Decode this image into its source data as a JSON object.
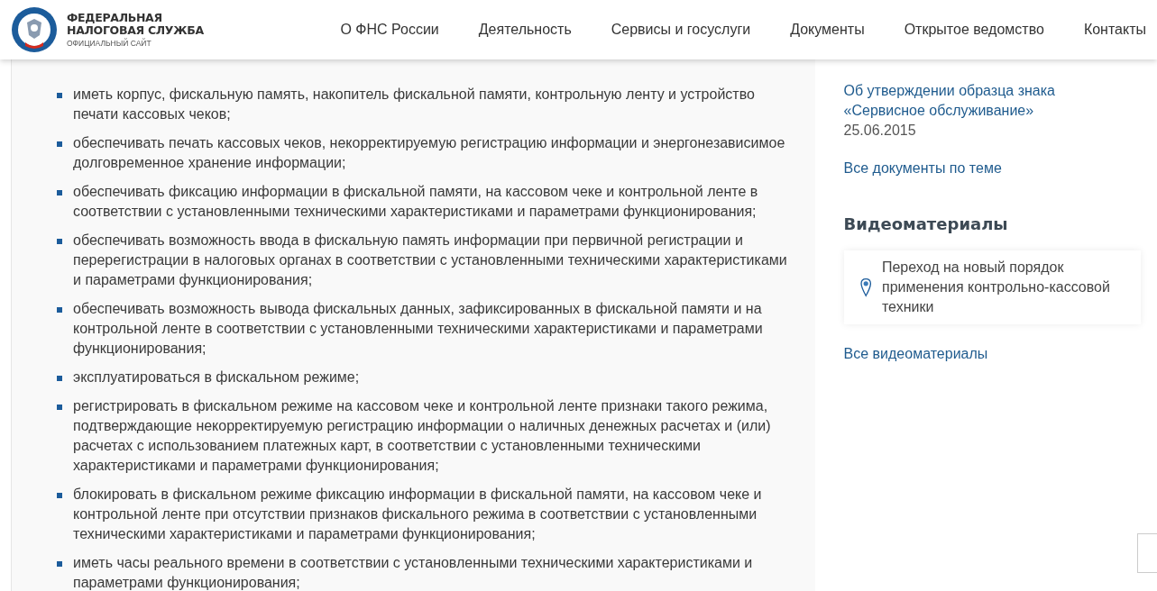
{
  "header": {
    "logo_title_line1": "ФЕДЕРАЛЬНАЯ",
    "logo_title_line2": "НАЛОГОВАЯ СЛУЖБА",
    "logo_subtitle": "ОФИЦИАЛЬНЫЙ САЙТ",
    "nav": [
      "О ФНС России",
      "Деятельность",
      "Сервисы и госуслуги",
      "Документы",
      "Открытое ведомство",
      "Контакты"
    ]
  },
  "requirements": [
    "иметь корпус, фискальную память, накопитель фискальной памяти, контрольную ленту и устройство печати кассовых чеков;",
    "обеспечивать печать кассовых чеков, некорректируемую регистрацию информации и энергонезависимое долговременное хранение информации;",
    "обеспечивать фиксацию информации в фискальной памяти, на кассовом чеке и контрольной ленте в соответствии с установленными техническими характеристиками и параметрами функционирования;",
    "обеспечивать возможность ввода в фискальную память информации при первичной регистрации и перерегистрации в налоговых органах в соответствии с установленными техническими характеристиками и параметрами функционирования;",
    "обеспечивать возможность вывода фискальных данных, зафиксированных в фискальной памяти и на контрольной ленте в соответствии с установленными техническими характеристиками и параметрами функционирования;",
    "эксплуатироваться в фискальном режиме;",
    "регистрировать в фискальном режиме на кассовом чеке и контрольной ленте признаки такого режима, подтверждающие некорректируемую регистрацию информации о наличных денежных расчетах и (или) расчетах с использованием платежных карт, в соответствии с установленными техническими характеристиками и параметрами функционирования;",
    "блокировать в фискальном режиме фиксацию информации в фискальной памяти, на кассовом чеке и контрольной ленте при отсутствии признаков фискального режима в соответствии с установленными техническими характеристиками и параметрами функционирования;",
    "иметь часы реального времени в соответствии с установленными техническими характеристиками и параметрами функционирования;"
  ],
  "sidebar": {
    "document_link": "Об утверждении образца знака «Сервисное обслуживание»",
    "document_date": "25.06.2015",
    "all_documents": "Все документы по теме",
    "video_heading": "Видеоматериалы",
    "video_title": "Переход на новый порядок применения контрольно-кассовой техники",
    "all_videos": "Все видеоматериалы"
  }
}
